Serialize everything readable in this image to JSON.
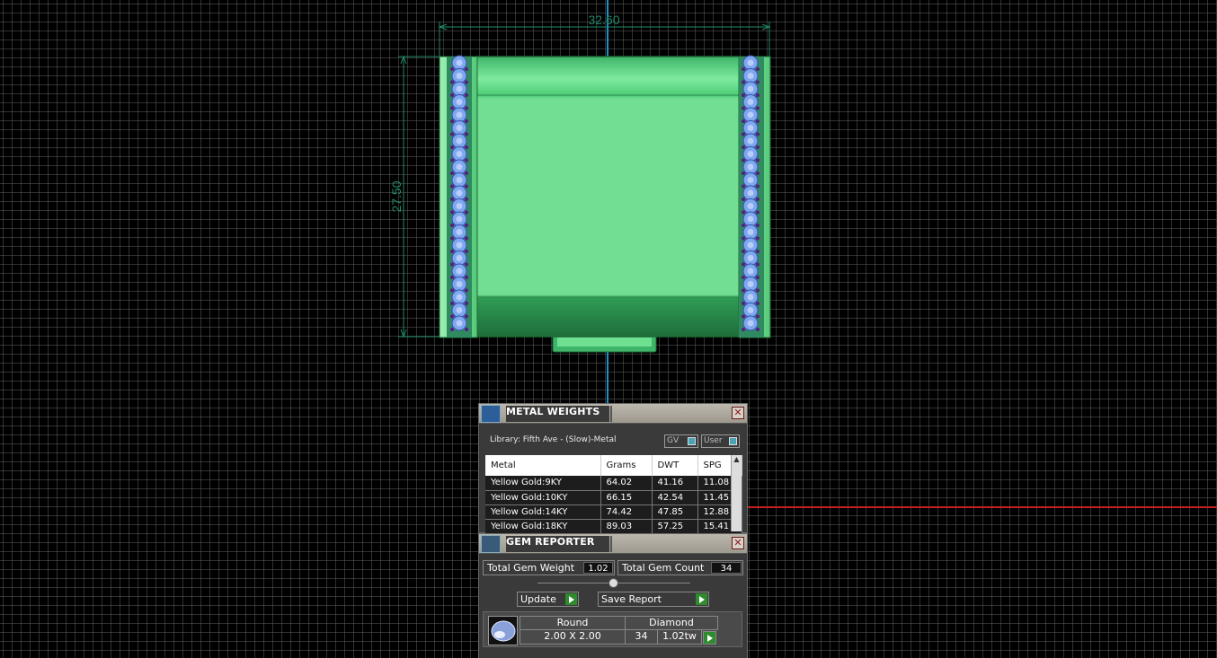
{
  "viewport": {
    "dimension_width": "32.60",
    "dimension_height": "27.50"
  },
  "metal_weights": {
    "title": "METAL WEIGHTS",
    "library_label": "Library: Fifth Ave - (Slow)-Metal",
    "toggle_gv": "GV",
    "toggle_user": "User",
    "columns": [
      "Metal",
      "Grams",
      "DWT",
      "SPG"
    ],
    "rows": [
      [
        "Yellow Gold:9KY",
        "64.02",
        "41.16",
        "11.08"
      ],
      [
        "Yellow Gold:10KY",
        "66.15",
        "42.54",
        "11.45"
      ],
      [
        "Yellow Gold:14KY",
        "74.42",
        "47.85",
        "12.88"
      ],
      [
        "Yellow Gold:18KY",
        "89.03",
        "57.25",
        "15.41"
      ]
    ]
  },
  "gem_reporter": {
    "title": "GEM REPORTER",
    "total_weight_label": "Total Gem Weight",
    "total_weight_value": "1.02",
    "total_count_label": "Total Gem Count",
    "total_count_value": "34",
    "update_label": "Update",
    "save_report_label": "Save Report",
    "gem": {
      "shape": "Round",
      "type": "Diamond",
      "size": "2.00 X 2.00",
      "count": "34",
      "weight": "1.02tw"
    }
  },
  "colors": {
    "band": "#5fd98a",
    "gem_blue": "#7fa7f0",
    "dimension": "#1f8a6a",
    "axis_blue": "#1e90c8",
    "axis_red": "#c02020"
  }
}
